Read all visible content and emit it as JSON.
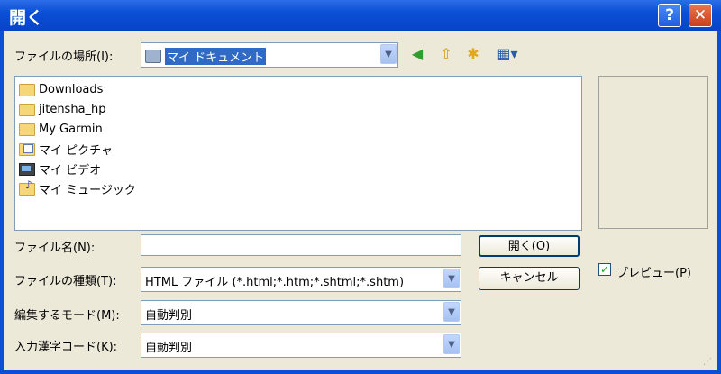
{
  "window": {
    "title": "開く",
    "help": "?",
    "close": "✕"
  },
  "location": {
    "label": "ファイルの場所(I):",
    "value": "マイ ドキュメント"
  },
  "toolbar": {
    "back": "◀",
    "up": "⇧",
    "new_folder": "✱",
    "views": "▦▾"
  },
  "files": [
    {
      "name": "Downloads",
      "icon": "folder-icon"
    },
    {
      "name": "jitensha_hp",
      "icon": "folder-icon"
    },
    {
      "name": "My Garmin",
      "icon": "folder-icon"
    },
    {
      "name": "マイ ピクチャ",
      "icon": "my-pictures-icon"
    },
    {
      "name": "マイ ビデオ",
      "icon": "my-videos-icon"
    },
    {
      "name": "マイ ミュージック",
      "icon": "my-music-icon"
    }
  ],
  "filename": {
    "label": "ファイル名(N):",
    "value": ""
  },
  "filetype": {
    "label": "ファイルの種類(T):",
    "value": "HTML ファイル (*.html;*.htm;*.shtml;*.shtm)"
  },
  "editmode": {
    "label": "編集するモード(M):",
    "value": "自動判別"
  },
  "charcode": {
    "label": "入力漢字コード(K):",
    "value": "自動判別"
  },
  "buttons": {
    "open": "開く(O)",
    "cancel": "キャンセル"
  },
  "preview_checkbox": {
    "label": "プレビュー(P)",
    "checked": true,
    "mark": "✓"
  }
}
